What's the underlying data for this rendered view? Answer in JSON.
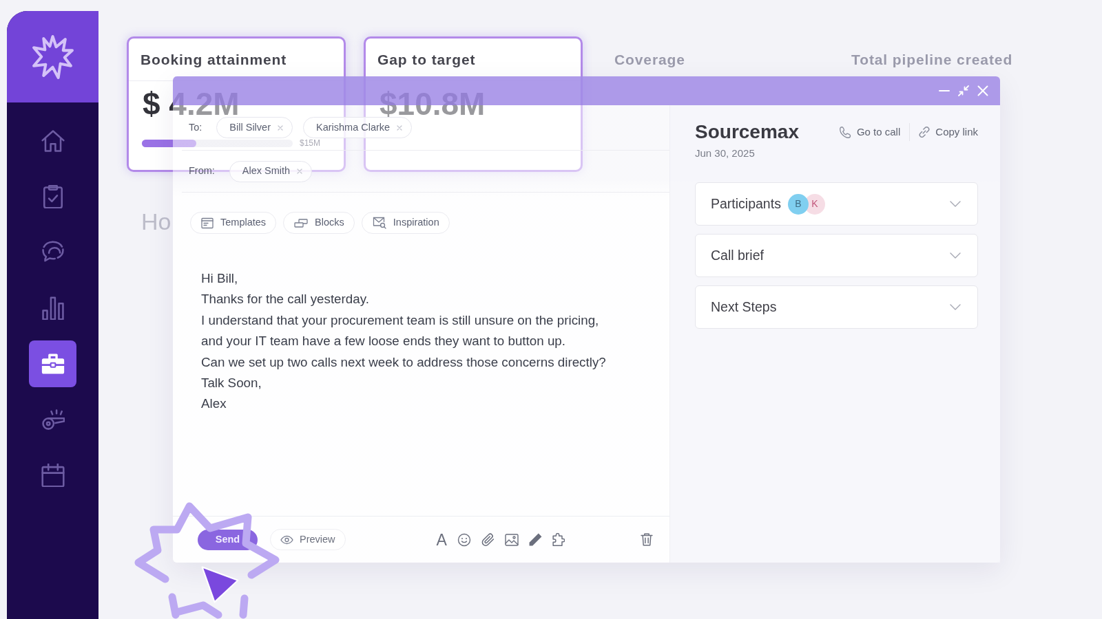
{
  "sidebar": {
    "items": [
      {
        "selected": false
      },
      {
        "selected": false
      },
      {
        "selected": false
      },
      {
        "selected": false
      },
      {
        "selected": true
      },
      {
        "selected": false
      },
      {
        "selected": false
      }
    ]
  },
  "kpis": [
    {
      "title": "Booking attainment",
      "highlighted": true,
      "value": "$ 4.2M",
      "level": 0.36,
      "target": "$15M"
    },
    {
      "title": "Gap to target",
      "highlighted": true,
      "value": "$10.8M"
    },
    {
      "title": "Coverage",
      "highlighted": false
    },
    {
      "title": "Total pipeline created",
      "highlighted": false
    }
  ],
  "section_title": "Ho",
  "composer": {
    "to_label": "To:",
    "to": [
      "Bill Silver",
      "Karishma Clarke"
    ],
    "from_label": "From:",
    "from": [
      "Alex Smith"
    ],
    "tools": [
      "Templates",
      "Blocks",
      "Inspiration"
    ],
    "body": [
      "Hi Bill,",
      "Thanks for the call yesterday.",
      "I understand that your procurement team is still unsure on the pricing,",
      "and your IT team have a few loose ends they want to button up.",
      "Can we set up two calls next week to address those concerns directly?",
      "Talk Soon,",
      "Alex"
    ],
    "send": "Send",
    "preview": "Preview",
    "format_label": "A"
  },
  "call": {
    "title": "Sourcemax",
    "date": "Jun 30, 2025",
    "actions": [
      "Go to call",
      "Copy link"
    ],
    "sections": [
      {
        "title": "Participants",
        "expanded": false,
        "participants": [
          {
            "initial": "B",
            "color": "#80cff0"
          },
          {
            "initial": "K",
            "color": "#f6dde5"
          }
        ]
      },
      {
        "title": "Call brief",
        "expanded": false
      },
      {
        "title": "Next Steps",
        "expanded": false
      }
    ]
  }
}
